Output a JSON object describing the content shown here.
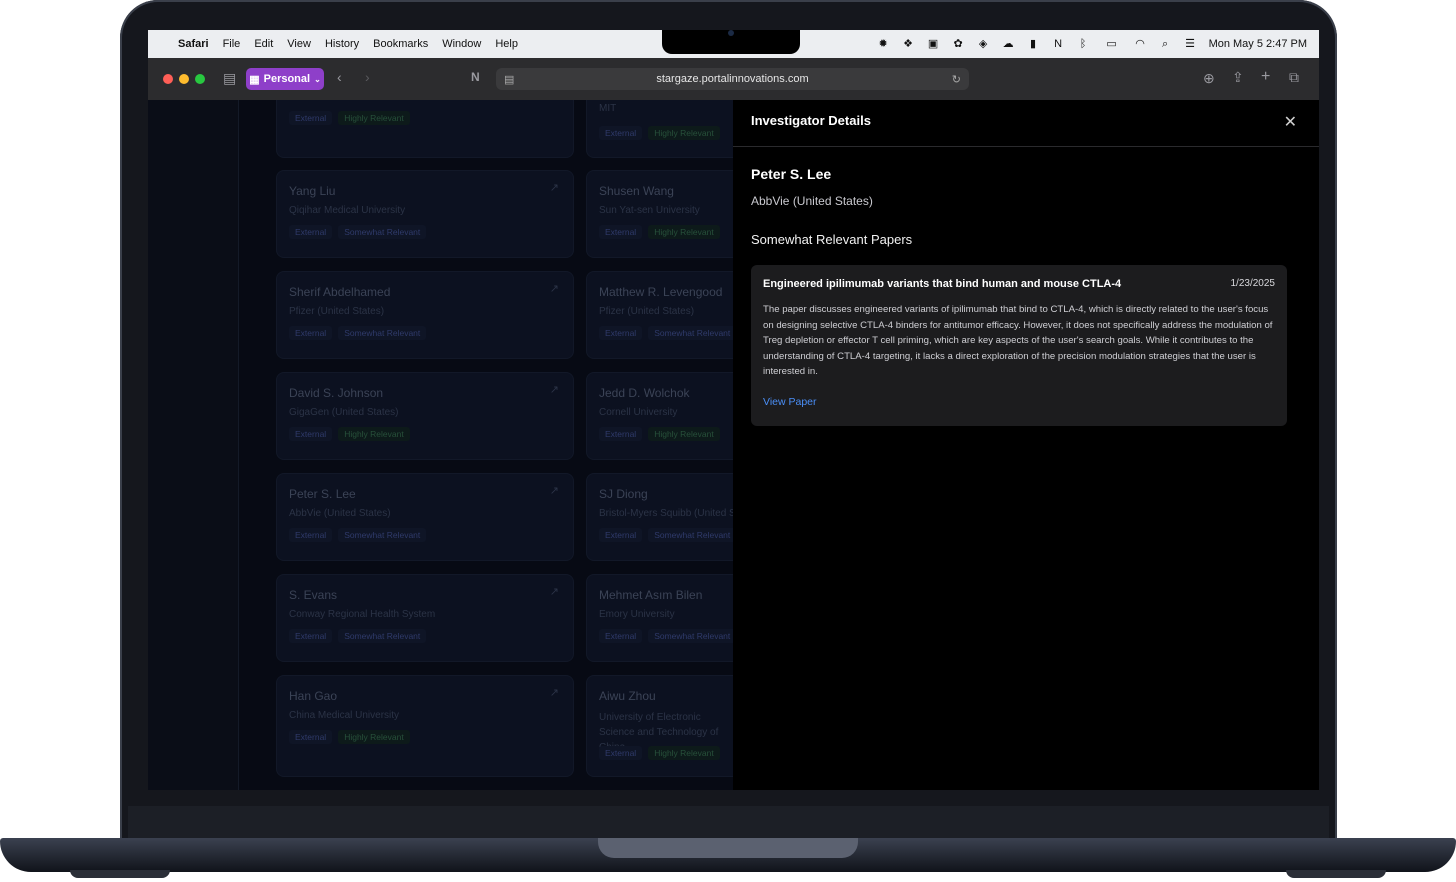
{
  "menubar": {
    "app": "Safari",
    "items": [
      "File",
      "Edit",
      "View",
      "History",
      "Bookmarks",
      "Window",
      "Help"
    ],
    "clock": "Mon May 5  2:47 PM"
  },
  "toolbar": {
    "profile": "Personal",
    "url": "stargaze.portalinnovations.com"
  },
  "cards": [
    {
      "name": "",
      "affiliation": "",
      "tags": [
        "External",
        "Highly Relevant"
      ]
    },
    {
      "name": "",
      "affiliation": "MIT",
      "tags": [
        "External",
        "Highly Relevant"
      ]
    },
    {
      "name": "Yang Liu",
      "affiliation": "Qiqihar Medical University",
      "tags": [
        "External",
        "Somewhat Relevant"
      ]
    },
    {
      "name": "Shusen Wang",
      "affiliation": "Sun Yat-sen University",
      "tags": [
        "External",
        "Highly Relevant"
      ]
    },
    {
      "name": "Sherif Abdelhamed",
      "affiliation": "Pfizer (United States)",
      "tags": [
        "External",
        "Somewhat Relevant"
      ]
    },
    {
      "name": "Matthew R. Levengood",
      "affiliation": "Pfizer (United States)",
      "tags": [
        "External",
        "Somewhat Relevant"
      ]
    },
    {
      "name": "David S. Johnson",
      "affiliation": "GigaGen (United States)",
      "tags": [
        "External",
        "Highly Relevant"
      ]
    },
    {
      "name": "Jedd D. Wolchok",
      "affiliation": "Cornell University",
      "tags": [
        "External",
        "Highly Relevant"
      ]
    },
    {
      "name": "Peter S. Lee",
      "affiliation": "AbbVie (United States)",
      "tags": [
        "External",
        "Somewhat Relevant"
      ]
    },
    {
      "name": "SJ Diong",
      "affiliation": "Bristol-Myers Squibb (United States)",
      "tags": [
        "External",
        "Somewhat Relevant"
      ]
    },
    {
      "name": "S. Evans",
      "affiliation": "Conway Regional Health System",
      "tags": [
        "External",
        "Somewhat Relevant"
      ]
    },
    {
      "name": "Mehmet Asım Bilen",
      "affiliation": "Emory University",
      "tags": [
        "External",
        "Somewhat Relevant"
      ]
    },
    {
      "name": "Han Gao",
      "affiliation": "China Medical University",
      "tags": [
        "External",
        "Highly Relevant"
      ]
    },
    {
      "name": "Aiwu Zhou",
      "affiliation": "University of Electronic Science and Technology of China",
      "tags": [
        "External",
        "Highly Relevant"
      ]
    }
  ],
  "drawer": {
    "title": "Investigator Details",
    "name": "Peter S. Lee",
    "affiliation": "AbbVie (United States)",
    "section": "Somewhat Relevant Papers",
    "paper": {
      "title": "Engineered ipilimumab variants that bind human and mouse CTLA-4",
      "date": "1/23/2025",
      "description": "The paper discusses engineered variants of ipilimumab that bind to CTLA-4, which is directly related to the user's focus on designing selective CTLA-4 binders for antitumor efficacy. However, it does not specifically address the modulation of Treg depletion or effector T cell priming, which are key aspects of the user's search goals. While it contributes to the understanding of CTLA-4 targeting, it lacks a direct exploration of the precision modulation strategies that the user is interested in.",
      "link": "View Paper"
    }
  }
}
